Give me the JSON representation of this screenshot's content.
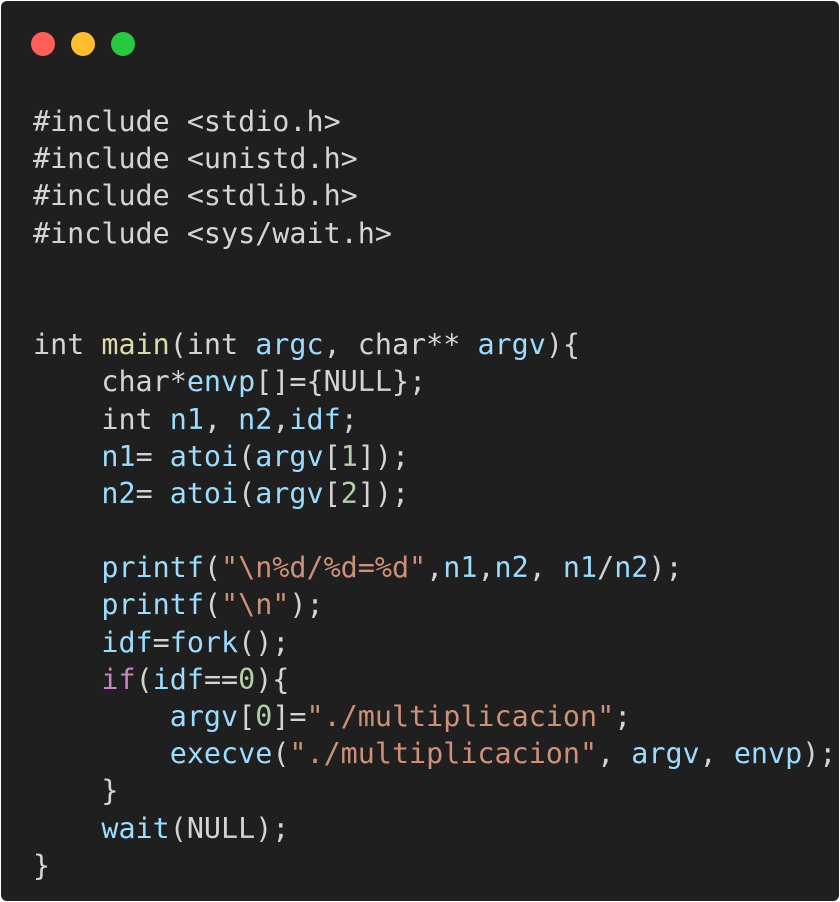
{
  "window": {
    "controls": [
      {
        "name": "close",
        "color": "#ff5f57"
      },
      {
        "name": "minimize",
        "color": "#febc2e"
      },
      {
        "name": "zoom",
        "color": "#28c840"
      }
    ]
  },
  "colors": {
    "background": "#1f1f1f",
    "plain": "#d4d4d4",
    "function": "#dcdcaa",
    "variable": "#9cdcfe",
    "number": "#b5cea8",
    "string": "#ce9178",
    "keyword": "#c586c0"
  },
  "code": {
    "lines": [
      [
        {
          "t": "#include <stdio.h>",
          "c": "plain"
        }
      ],
      [
        {
          "t": "#include <unistd.h>",
          "c": "plain"
        }
      ],
      [
        {
          "t": "#include <stdlib.h>",
          "c": "plain"
        }
      ],
      [
        {
          "t": "#include <sys/wait.h>",
          "c": "plain"
        }
      ],
      [],
      [],
      [
        {
          "t": "int ",
          "c": "plain"
        },
        {
          "t": "main",
          "c": "func"
        },
        {
          "t": "(int ",
          "c": "plain"
        },
        {
          "t": "argc",
          "c": "var"
        },
        {
          "t": ", char** ",
          "c": "plain"
        },
        {
          "t": "argv",
          "c": "var"
        },
        {
          "t": "){",
          "c": "plain"
        }
      ],
      [
        {
          "t": "    char*",
          "c": "plain"
        },
        {
          "t": "envp",
          "c": "var"
        },
        {
          "t": "[]={NULL};",
          "c": "plain"
        }
      ],
      [
        {
          "t": "    int ",
          "c": "plain"
        },
        {
          "t": "n1",
          "c": "var"
        },
        {
          "t": ", ",
          "c": "plain"
        },
        {
          "t": "n2",
          "c": "var"
        },
        {
          "t": ",",
          "c": "plain"
        },
        {
          "t": "idf",
          "c": "var"
        },
        {
          "t": ";",
          "c": "plain"
        }
      ],
      [
        {
          "t": "    ",
          "c": "plain"
        },
        {
          "t": "n1",
          "c": "var"
        },
        {
          "t": "= ",
          "c": "plain"
        },
        {
          "t": "atoi",
          "c": "var"
        },
        {
          "t": "(",
          "c": "plain"
        },
        {
          "t": "argv",
          "c": "var"
        },
        {
          "t": "[",
          "c": "plain"
        },
        {
          "t": "1",
          "c": "num"
        },
        {
          "t": "]);",
          "c": "plain"
        }
      ],
      [
        {
          "t": "    ",
          "c": "plain"
        },
        {
          "t": "n2",
          "c": "var"
        },
        {
          "t": "= ",
          "c": "plain"
        },
        {
          "t": "atoi",
          "c": "var"
        },
        {
          "t": "(",
          "c": "plain"
        },
        {
          "t": "argv",
          "c": "var"
        },
        {
          "t": "[",
          "c": "plain"
        },
        {
          "t": "2",
          "c": "num"
        },
        {
          "t": "]);",
          "c": "plain"
        }
      ],
      [],
      [
        {
          "t": "    ",
          "c": "plain"
        },
        {
          "t": "printf",
          "c": "var"
        },
        {
          "t": "(",
          "c": "plain"
        },
        {
          "t": "\"\\n%d/%d=%d\"",
          "c": "str"
        },
        {
          "t": ",",
          "c": "plain"
        },
        {
          "t": "n1",
          "c": "var"
        },
        {
          "t": ",",
          "c": "plain"
        },
        {
          "t": "n2",
          "c": "var"
        },
        {
          "t": ", ",
          "c": "plain"
        },
        {
          "t": "n1",
          "c": "var"
        },
        {
          "t": "/",
          "c": "plain"
        },
        {
          "t": "n2",
          "c": "var"
        },
        {
          "t": ");",
          "c": "plain"
        }
      ],
      [
        {
          "t": "    ",
          "c": "plain"
        },
        {
          "t": "printf",
          "c": "var"
        },
        {
          "t": "(",
          "c": "plain"
        },
        {
          "t": "\"\\n\"",
          "c": "str"
        },
        {
          "t": ");",
          "c": "plain"
        }
      ],
      [
        {
          "t": "    ",
          "c": "plain"
        },
        {
          "t": "idf",
          "c": "var"
        },
        {
          "t": "=",
          "c": "plain"
        },
        {
          "t": "fork",
          "c": "var"
        },
        {
          "t": "();",
          "c": "plain"
        }
      ],
      [
        {
          "t": "    ",
          "c": "plain"
        },
        {
          "t": "if",
          "c": "keyword"
        },
        {
          "t": "(",
          "c": "plain"
        },
        {
          "t": "idf",
          "c": "var"
        },
        {
          "t": "==",
          "c": "plain"
        },
        {
          "t": "0",
          "c": "num"
        },
        {
          "t": "){",
          "c": "plain"
        }
      ],
      [
        {
          "t": "        ",
          "c": "plain"
        },
        {
          "t": "argv",
          "c": "var"
        },
        {
          "t": "[",
          "c": "plain"
        },
        {
          "t": "0",
          "c": "num"
        },
        {
          "t": "]=",
          "c": "plain"
        },
        {
          "t": "\"./multiplicacion\"",
          "c": "str"
        },
        {
          "t": ";",
          "c": "plain"
        }
      ],
      [
        {
          "t": "        ",
          "c": "plain"
        },
        {
          "t": "execve",
          "c": "var"
        },
        {
          "t": "(",
          "c": "plain"
        },
        {
          "t": "\"./multiplicacion\"",
          "c": "str"
        },
        {
          "t": ", ",
          "c": "plain"
        },
        {
          "t": "argv",
          "c": "var"
        },
        {
          "t": ", ",
          "c": "plain"
        },
        {
          "t": "envp",
          "c": "var"
        },
        {
          "t": ");",
          "c": "plain"
        }
      ],
      [
        {
          "t": "    }",
          "c": "plain"
        }
      ],
      [
        {
          "t": "    ",
          "c": "plain"
        },
        {
          "t": "wait",
          "c": "var"
        },
        {
          "t": "(NULL);",
          "c": "plain"
        }
      ],
      [
        {
          "t": "}",
          "c": "plain"
        }
      ]
    ]
  }
}
